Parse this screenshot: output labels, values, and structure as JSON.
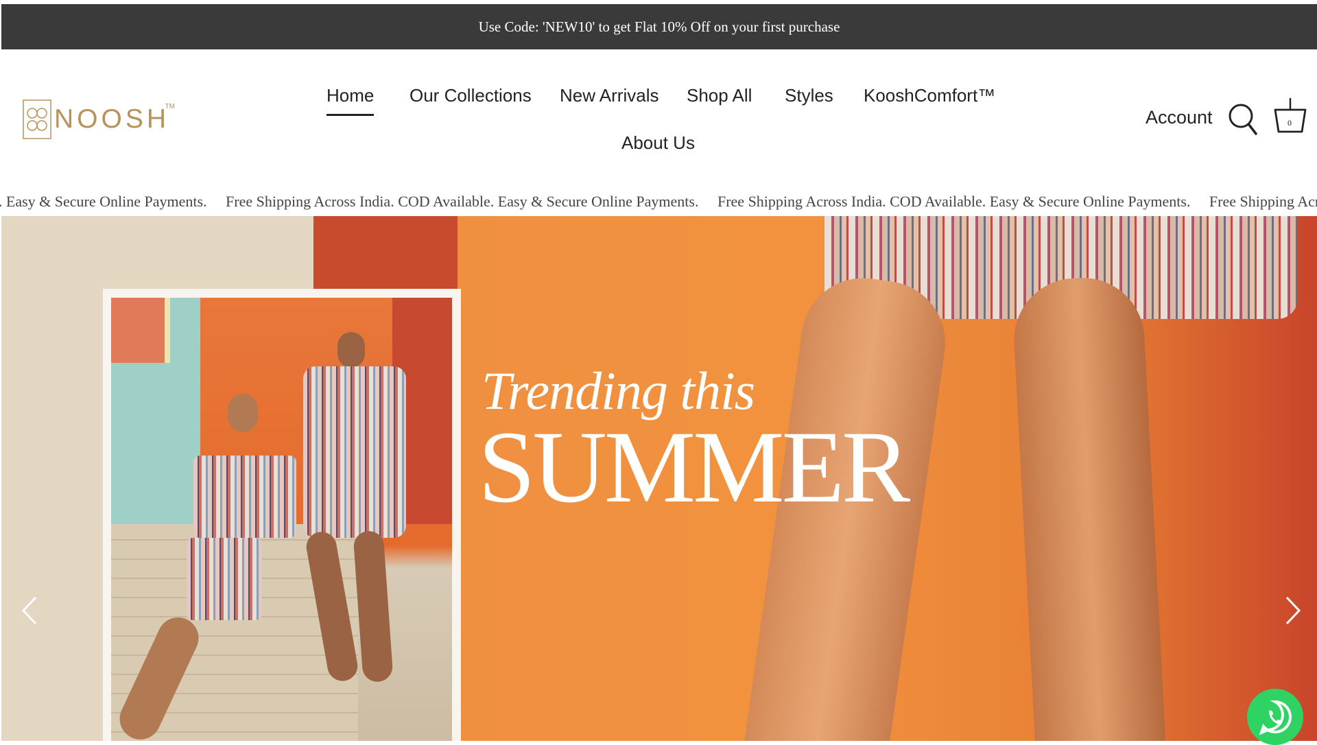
{
  "announcement": {
    "text": "Use Code: 'NEW10' to get Flat 10% Off on your first purchase"
  },
  "brand": {
    "name": "NOOSH",
    "trademark": "TM",
    "color": "#b8925a"
  },
  "nav": {
    "items": [
      {
        "label": "Home",
        "active": true
      },
      {
        "label": "Our Collections"
      },
      {
        "label": "New Arrivals"
      },
      {
        "label": "Shop All"
      },
      {
        "label": "Styles"
      },
      {
        "label": "KooshComfort™"
      },
      {
        "label": "About Us"
      }
    ]
  },
  "header_actions": {
    "account_label": "Account",
    "search_icon": "search-icon",
    "cart_icon": "cart-icon",
    "cart_count": "0"
  },
  "marquee": {
    "items": [
      "le. Easy & Secure Online Payments.",
      "Free Shipping Across India. COD Available. Easy & Secure Online Payments.",
      "Free Shipping Across India. COD Available. Easy & Secure Online Payments.",
      "Free Shipping Across India. COD"
    ]
  },
  "hero": {
    "headline_script": "Trending this",
    "headline_main": "SUMMER",
    "prev_icon": "chevron-left-icon",
    "next_icon": "chevron-right-icon"
  },
  "chat": {
    "icon": "whatsapp-icon",
    "color": "#2fd363"
  }
}
